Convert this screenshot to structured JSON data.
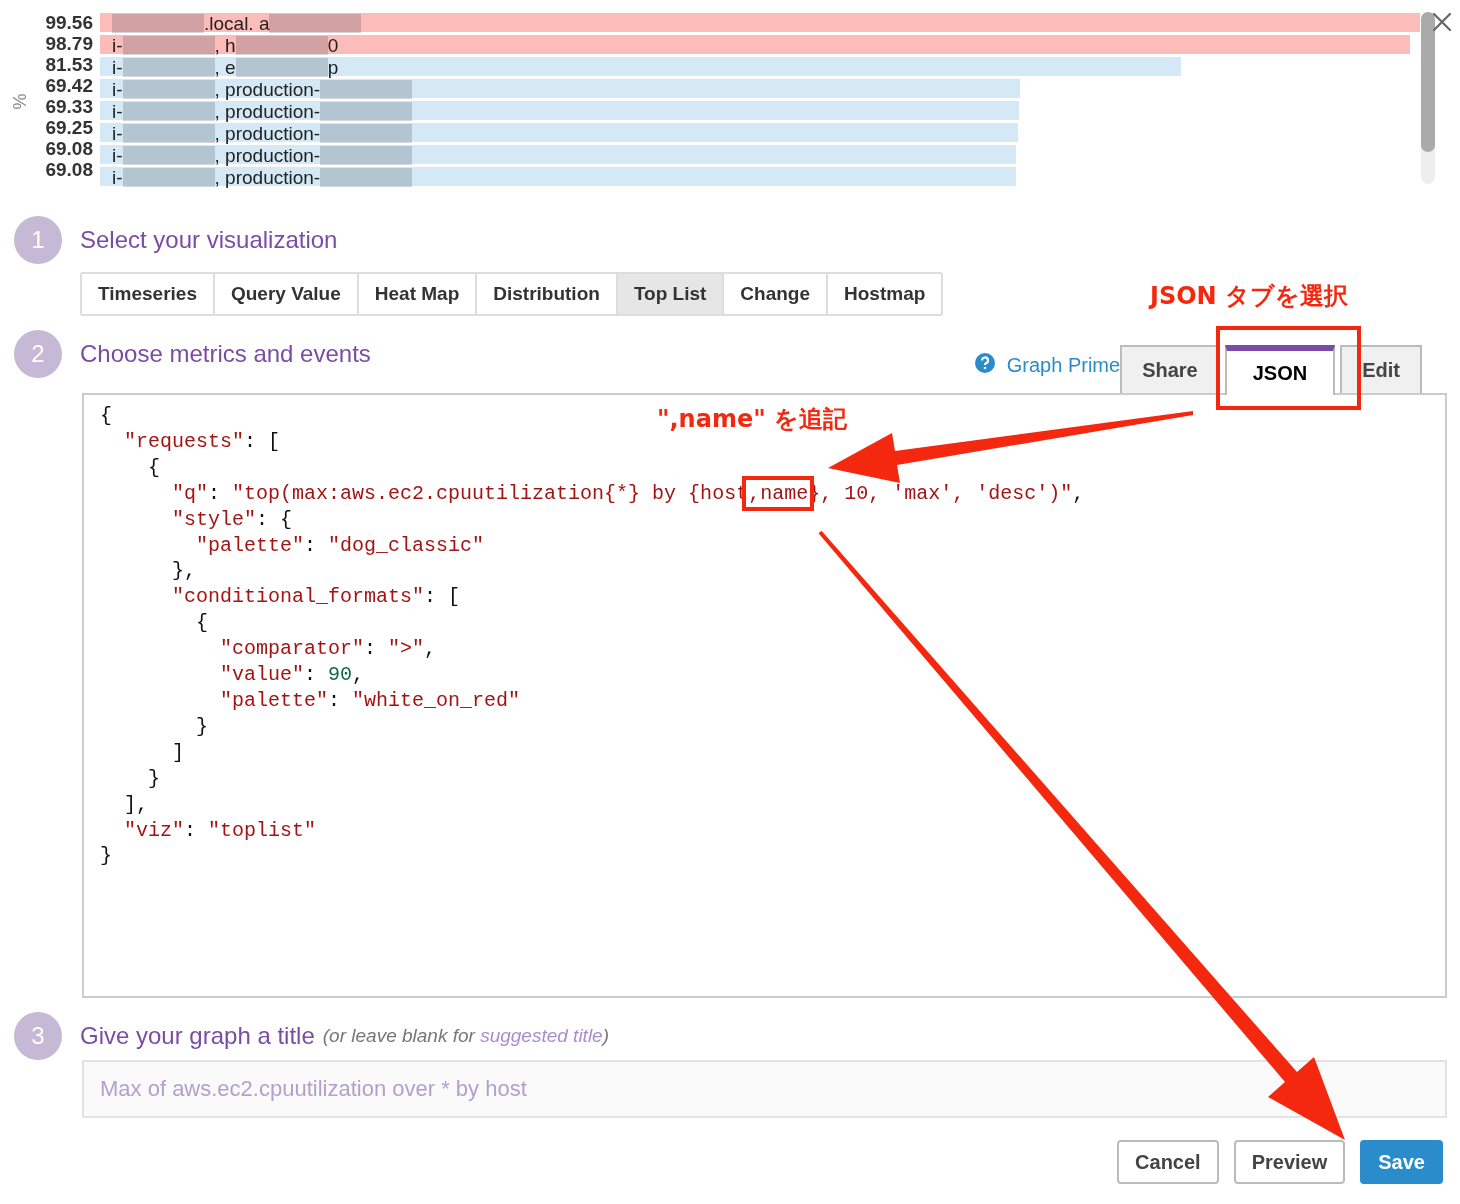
{
  "chart": {
    "axis_label": "%",
    "rows": [
      {
        "value": "99.56",
        "color": "#fbbcba",
        "label": [
          {
            "kind": "redacted"
          },
          {
            "kind": "text",
            "text": ".local. a"
          },
          {
            "kind": "redacted"
          }
        ]
      },
      {
        "value": "98.79",
        "color": "#fbbcba",
        "label": [
          {
            "kind": "text",
            "text": "i-"
          },
          {
            "kind": "redacted"
          },
          {
            "kind": "text",
            "text": ", h"
          },
          {
            "kind": "redacted"
          },
          {
            "kind": "text",
            "text": "0"
          }
        ]
      },
      {
        "value": "81.53",
        "color": "#d4e9f5",
        "label": [
          {
            "kind": "text",
            "text": "i-"
          },
          {
            "kind": "redacted"
          },
          {
            "kind": "text",
            "text": ", e"
          },
          {
            "kind": "redacted"
          },
          {
            "kind": "text",
            "text": "p"
          }
        ]
      },
      {
        "value": "69.42",
        "color": "#d4e9f5",
        "label": [
          {
            "kind": "text",
            "text": "i-"
          },
          {
            "kind": "redacted"
          },
          {
            "kind": "text",
            "text": ", production-"
          },
          {
            "kind": "redacted"
          }
        ]
      },
      {
        "value": "69.33",
        "color": "#d4e9f5",
        "label": [
          {
            "kind": "text",
            "text": "i-"
          },
          {
            "kind": "redacted"
          },
          {
            "kind": "text",
            "text": ", production-"
          },
          {
            "kind": "redacted"
          }
        ]
      },
      {
        "value": "69.25",
        "color": "#d4e9f5",
        "label": [
          {
            "kind": "text",
            "text": "i-"
          },
          {
            "kind": "redacted"
          },
          {
            "kind": "text",
            "text": ", production-"
          },
          {
            "kind": "redacted"
          }
        ]
      },
      {
        "value": "69.08",
        "color": "#d4e9f5",
        "label": [
          {
            "kind": "text",
            "text": "i-"
          },
          {
            "kind": "redacted"
          },
          {
            "kind": "text",
            "text": ", production-"
          },
          {
            "kind": "redacted"
          }
        ]
      },
      {
        "value": "69.08",
        "color": "#d4e9f5",
        "label": [
          {
            "kind": "text",
            "text": "i-"
          },
          {
            "kind": "redacted"
          },
          {
            "kind": "text",
            "text": ", production-"
          },
          {
            "kind": "redacted"
          }
        ]
      }
    ]
  },
  "step1": {
    "number": "1",
    "title": "Select your visualization",
    "tabs": [
      {
        "label": "Timeseries",
        "selected": false
      },
      {
        "label": "Query Value",
        "selected": false
      },
      {
        "label": "Heat Map",
        "selected": false
      },
      {
        "label": "Distribution",
        "selected": false
      },
      {
        "label": "Top List",
        "selected": true
      },
      {
        "label": "Change",
        "selected": false
      },
      {
        "label": "Hostmap",
        "selected": false
      }
    ]
  },
  "step2": {
    "number": "2",
    "title": "Choose metrics and events",
    "help_link": "Graph Prime",
    "editor_tabs": [
      {
        "label": "Share",
        "selected": false
      },
      {
        "label": "JSON",
        "selected": true
      },
      {
        "label": "Edit",
        "selected": false
      }
    ],
    "code_lines": [
      [
        {
          "kind": "p",
          "text": "{"
        }
      ],
      [
        {
          "kind": "s",
          "text": "  \"requests\""
        },
        {
          "kind": "p",
          "text": ": ["
        }
      ],
      [
        {
          "kind": "p",
          "text": "    {"
        }
      ],
      [
        {
          "kind": "s",
          "text": "      \"q\""
        },
        {
          "kind": "p",
          "text": ": "
        },
        {
          "kind": "s",
          "text": "\"top(max:aws.ec2.cpuutilization{*} by {host"
        },
        {
          "kind": "s",
          "text": ",name",
          "highlighted": true
        },
        {
          "kind": "s",
          "text": "}, 10, 'max', 'desc')\""
        },
        {
          "kind": "p",
          "text": ","
        }
      ],
      [
        {
          "kind": "s",
          "text": "      \"style\""
        },
        {
          "kind": "p",
          "text": ": {"
        }
      ],
      [
        {
          "kind": "s",
          "text": "        \"palette\""
        },
        {
          "kind": "p",
          "text": ": "
        },
        {
          "kind": "s",
          "text": "\"dog_classic\""
        }
      ],
      [
        {
          "kind": "p",
          "text": "      },"
        }
      ],
      [
        {
          "kind": "s",
          "text": "      \"conditional_formats\""
        },
        {
          "kind": "p",
          "text": ": ["
        }
      ],
      [
        {
          "kind": "p",
          "text": "        {"
        }
      ],
      [
        {
          "kind": "s",
          "text": "          \"comparator\""
        },
        {
          "kind": "p",
          "text": ": "
        },
        {
          "kind": "s",
          "text": "\">\""
        },
        {
          "kind": "p",
          "text": ","
        }
      ],
      [
        {
          "kind": "s",
          "text": "          \"value\""
        },
        {
          "kind": "p",
          "text": ": "
        },
        {
          "kind": "n",
          "text": "90"
        },
        {
          "kind": "p",
          "text": ","
        }
      ],
      [
        {
          "kind": "s",
          "text": "          \"palette\""
        },
        {
          "kind": "p",
          "text": ": "
        },
        {
          "kind": "s",
          "text": "\"white_on_red\""
        }
      ],
      [
        {
          "kind": "p",
          "text": "        }"
        }
      ],
      [
        {
          "kind": "p",
          "text": "      ]"
        }
      ],
      [
        {
          "kind": "p",
          "text": "    }"
        }
      ],
      [
        {
          "kind": "p",
          "text": "  ],"
        }
      ],
      [
        {
          "kind": "s",
          "text": "  \"viz\""
        },
        {
          "kind": "p",
          "text": ": "
        },
        {
          "kind": "s",
          "text": "\"toplist\""
        }
      ],
      [
        {
          "kind": "p",
          "text": "}"
        }
      ]
    ]
  },
  "step3": {
    "number": "3",
    "title": "Give your graph a title",
    "hint_before": "(or leave blank for ",
    "hint_link": "suggested title",
    "hint_after": ")",
    "placeholder": "Max of aws.ec2.cpuutilization over * by host"
  },
  "buttons": [
    {
      "label": "Cancel",
      "kind": "default"
    },
    {
      "label": "Preview",
      "kind": "default"
    },
    {
      "label": "Save",
      "kind": "primary"
    }
  ],
  "annotations": {
    "tab_note": "JSON タブを選択",
    "code_note": "\",name\" を追記"
  }
}
